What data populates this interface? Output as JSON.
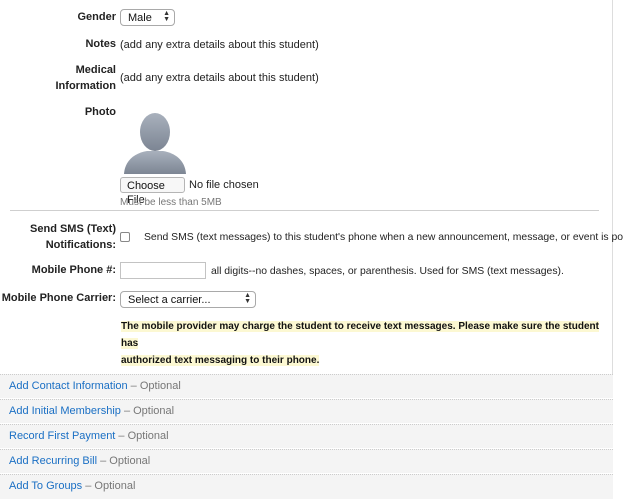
{
  "gender": {
    "label": "Gender",
    "selected": "Male"
  },
  "notes": {
    "label": "Notes",
    "link": "(add any extra details about this student)"
  },
  "medical": {
    "label_line1": "Medical",
    "label_line2": "Information",
    "link": "(add any extra details about this student)"
  },
  "photo": {
    "label": "Photo",
    "choose_file": "Choose File",
    "no_file": "No file chosen",
    "hint": "Must be less than 5MB"
  },
  "sms": {
    "label_line1": "Send SMS (Text)",
    "label_line2": "Notifications:",
    "checkbox_text": "Send SMS (text messages) to this student's phone when a new announcement, message, or event is posted."
  },
  "mobile_phone": {
    "label": "Mobile Phone #:",
    "value": "",
    "hint": "all digits--no dashes, spaces, or parenthesis. Used for SMS (text messages)."
  },
  "carrier": {
    "label": "Mobile Phone Carrier:",
    "selected": "Select a carrier..."
  },
  "notice": {
    "line1": "The mobile provider may charge the student to receive text messages. Please make sure the student has",
    "line2": "authorized text messaging to their phone."
  },
  "optional_sections": [
    {
      "link": "Add Contact Information",
      "suffix": " – Optional"
    },
    {
      "link": "Add Initial Membership",
      "suffix": " – Optional"
    },
    {
      "link": "Record First Payment",
      "suffix": " – Optional"
    },
    {
      "link": "Add Recurring Bill",
      "suffix": " – Optional"
    },
    {
      "link": "Add To Groups",
      "suffix": " – Optional"
    }
  ],
  "colors": {
    "link": "#1a6fc4",
    "notice_highlight": "#fcf8d2",
    "optional_row_bg": "#f4f4f4"
  },
  "icons": {
    "photo_placeholder": "default-avatar-icon",
    "select_arrows": "up-down-arrows-icon"
  }
}
